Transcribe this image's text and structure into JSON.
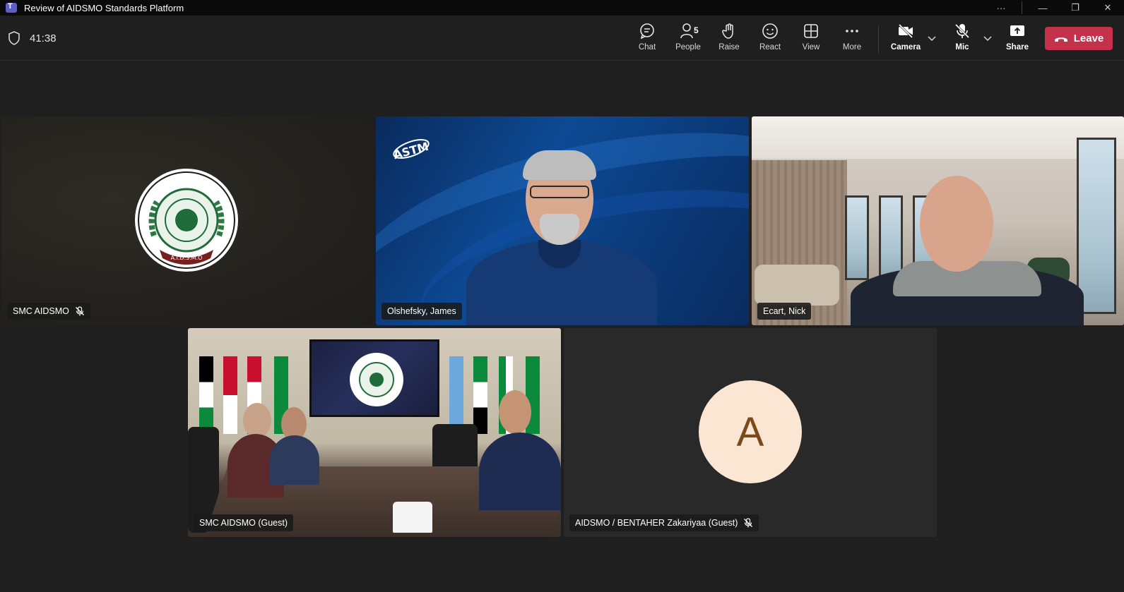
{
  "window": {
    "title": "Review of AIDSMO Standards Platform",
    "more": "···",
    "minimize": "—",
    "restore": "❐",
    "close": "✕"
  },
  "meeting": {
    "timer": "41:38"
  },
  "toolbar": {
    "chat": "Chat",
    "people": "People",
    "people_count": "5",
    "raise": "Raise",
    "react": "React",
    "view": "View",
    "more": "More",
    "camera": "Camera",
    "mic": "Mic",
    "share": "Share",
    "leave": "Leave"
  },
  "colors": {
    "leave": "#c4314b",
    "background": "#1f1f1f",
    "avatar_bg": "#fbe6d3",
    "avatar_text": "#7a4a1a"
  },
  "participants": [
    {
      "name": "SMC AIDSMO",
      "muted": true,
      "video": "logo"
    },
    {
      "name": "Olshefsky, James",
      "muted": false,
      "video": "camera"
    },
    {
      "name": "Ecart, Nick",
      "muted": false,
      "video": "camera"
    },
    {
      "name": "SMC AIDSMO (Guest)",
      "muted": false,
      "video": "camera"
    },
    {
      "name": "AIDSMO / BENTAHER Zakariyaa (Guest)",
      "muted": true,
      "video": "avatar",
      "initial": "A"
    }
  ],
  "logos": {
    "astm": "ASTM",
    "seal_text": "A.I.D.S.M.O"
  }
}
